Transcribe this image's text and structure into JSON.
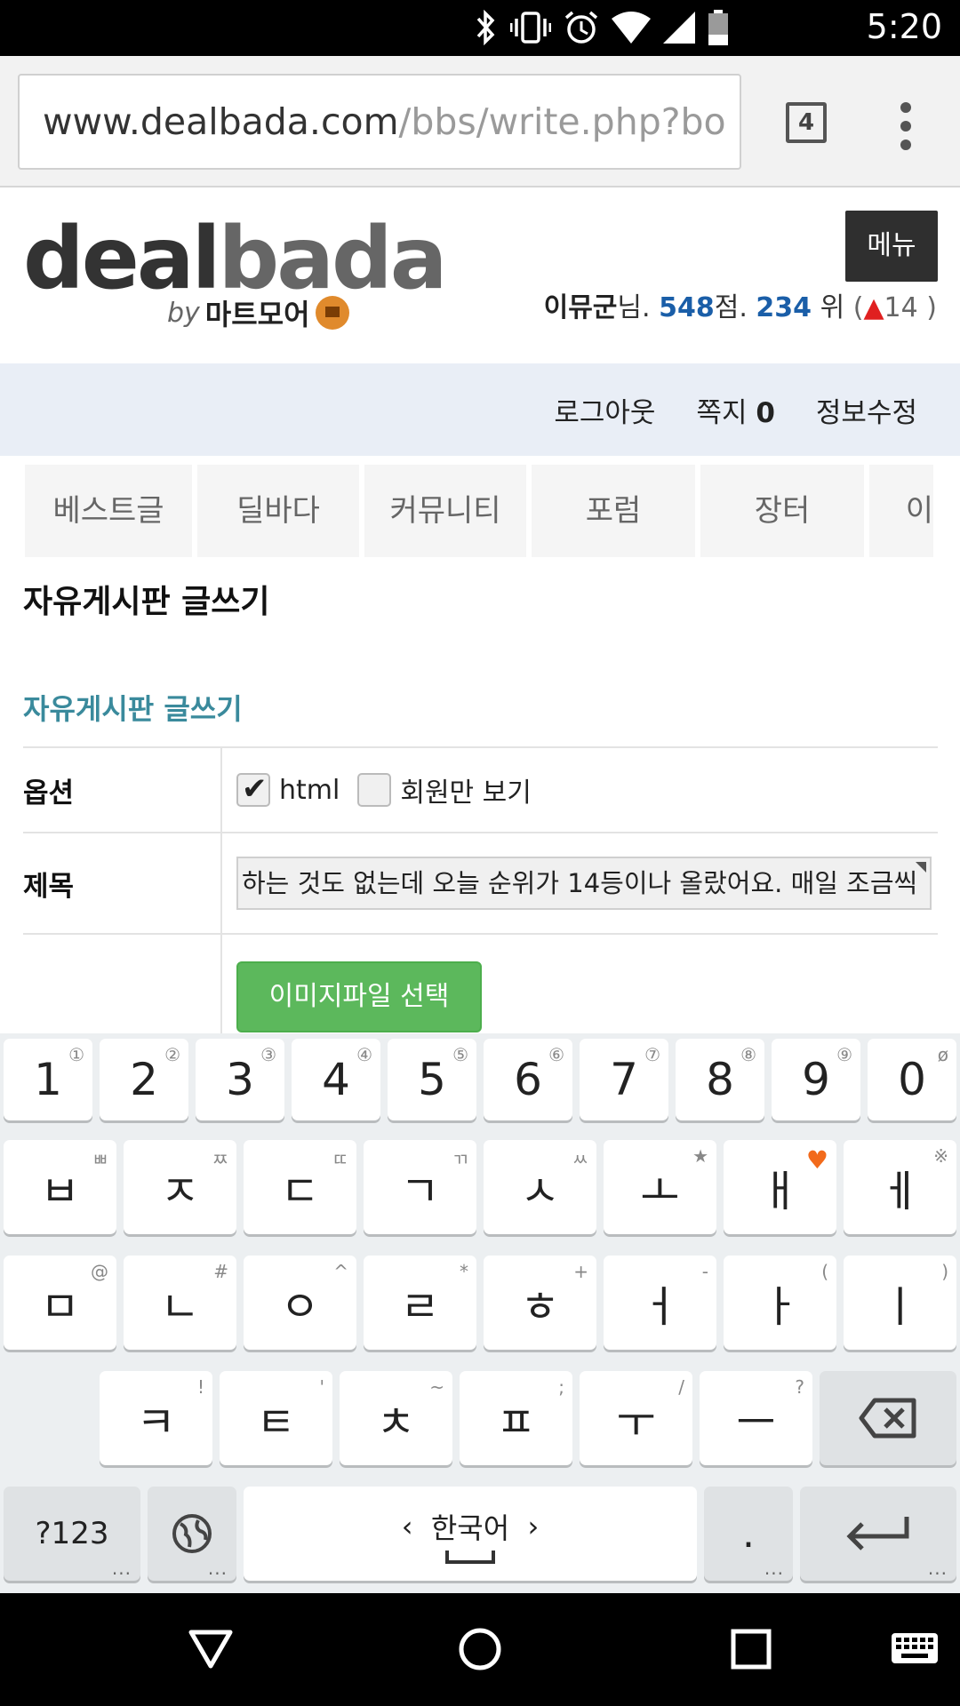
{
  "status_bar": {
    "time": "5:20",
    "icons": [
      "bluetooth-icon",
      "vibrate-icon",
      "alarm-icon",
      "wifi-icon",
      "signal-icon",
      "battery-icon"
    ]
  },
  "browser": {
    "url_host": "www.dealbada.com",
    "url_path": "/bbs/write.php?bo",
    "tab_count": "4"
  },
  "header": {
    "logo_part1": "deal",
    "logo_part2": "bada",
    "logo_by": "by",
    "logo_brand": "마트모어",
    "menu_label": "메뉴",
    "user_name": "이뮤군",
    "user_suffix": "님.",
    "points": "548",
    "points_suffix": "점.",
    "rank": "234",
    "rank_suffix": "위",
    "paren_open": "(",
    "rank_change": "14",
    "paren_close": ")"
  },
  "member_bar": {
    "logout": "로그아웃",
    "memo_label": "쪽지",
    "memo_count": "0",
    "edit_info": "정보수정"
  },
  "nav_tabs": [
    "베스트글",
    "딜바다",
    "커뮤니티",
    "포럼",
    "장터",
    "이"
  ],
  "page": {
    "heading": "자유게시판 글쓰기",
    "section_title": "자유게시판 글쓰기",
    "option_label": "옵션",
    "opt_html": "html",
    "opt_html_checked": true,
    "opt_members_only": "회원만 보기",
    "opt_members_checked": false,
    "subject_label": "제목",
    "subject_value": "하는 것도 없는데 오늘 순위가 14등이나 올랐어요. 매일 조금씩",
    "image_button": "이미지파일 선택"
  },
  "keyboard": {
    "numbers": [
      {
        "main": "1",
        "sup": "①"
      },
      {
        "main": "2",
        "sup": "②"
      },
      {
        "main": "3",
        "sup": "③"
      },
      {
        "main": "4",
        "sup": "④"
      },
      {
        "main": "5",
        "sup": "⑤"
      },
      {
        "main": "6",
        "sup": "⑥"
      },
      {
        "main": "7",
        "sup": "⑦"
      },
      {
        "main": "8",
        "sup": "⑧"
      },
      {
        "main": "9",
        "sup": "⑨"
      },
      {
        "main": "0",
        "sup": "ø"
      }
    ],
    "row1": [
      {
        "main": "ㅂ",
        "sup": "ㅃ"
      },
      {
        "main": "ㅈ",
        "sup": "ㅉ"
      },
      {
        "main": "ㄷ",
        "sup": "ㄸ"
      },
      {
        "main": "ㄱ",
        "sup": "ㄲ"
      },
      {
        "main": "ㅅ",
        "sup": "ㅆ"
      },
      {
        "main": "ㅗ",
        "sup": "★"
      },
      {
        "main": "ㅐ",
        "sup": "♥"
      },
      {
        "main": "ㅔ",
        "sup": "※"
      }
    ],
    "row2": [
      {
        "main": "ㅁ",
        "sup": "@"
      },
      {
        "main": "ㄴ",
        "sup": "#"
      },
      {
        "main": "ㅇ",
        "sup": "^"
      },
      {
        "main": "ㄹ",
        "sup": "*"
      },
      {
        "main": "ㅎ",
        "sup": "+"
      },
      {
        "main": "ㅓ",
        "sup": "-"
      },
      {
        "main": "ㅏ",
        "sup": "("
      },
      {
        "main": "ㅣ",
        "sup": ")"
      }
    ],
    "row3": [
      {
        "main": "ㅋ",
        "sup": "!"
      },
      {
        "main": "ㅌ",
        "sup": "'"
      },
      {
        "main": "ㅊ",
        "sup": "~"
      },
      {
        "main": "ㅍ",
        "sup": ";"
      },
      {
        "main": "ㅜ",
        "sup": "/"
      },
      {
        "main": "ㅡ",
        "sup": "?"
      }
    ],
    "symbols_key": "?123",
    "dots": "...",
    "space_label": "한국어",
    "period_key": ".",
    "icons": [
      "backspace-icon",
      "globe-icon",
      "enter-icon"
    ]
  },
  "nav_bar": {
    "icons": [
      "back-icon",
      "home-icon",
      "recents-icon",
      "keyboard-switch-icon"
    ]
  }
}
